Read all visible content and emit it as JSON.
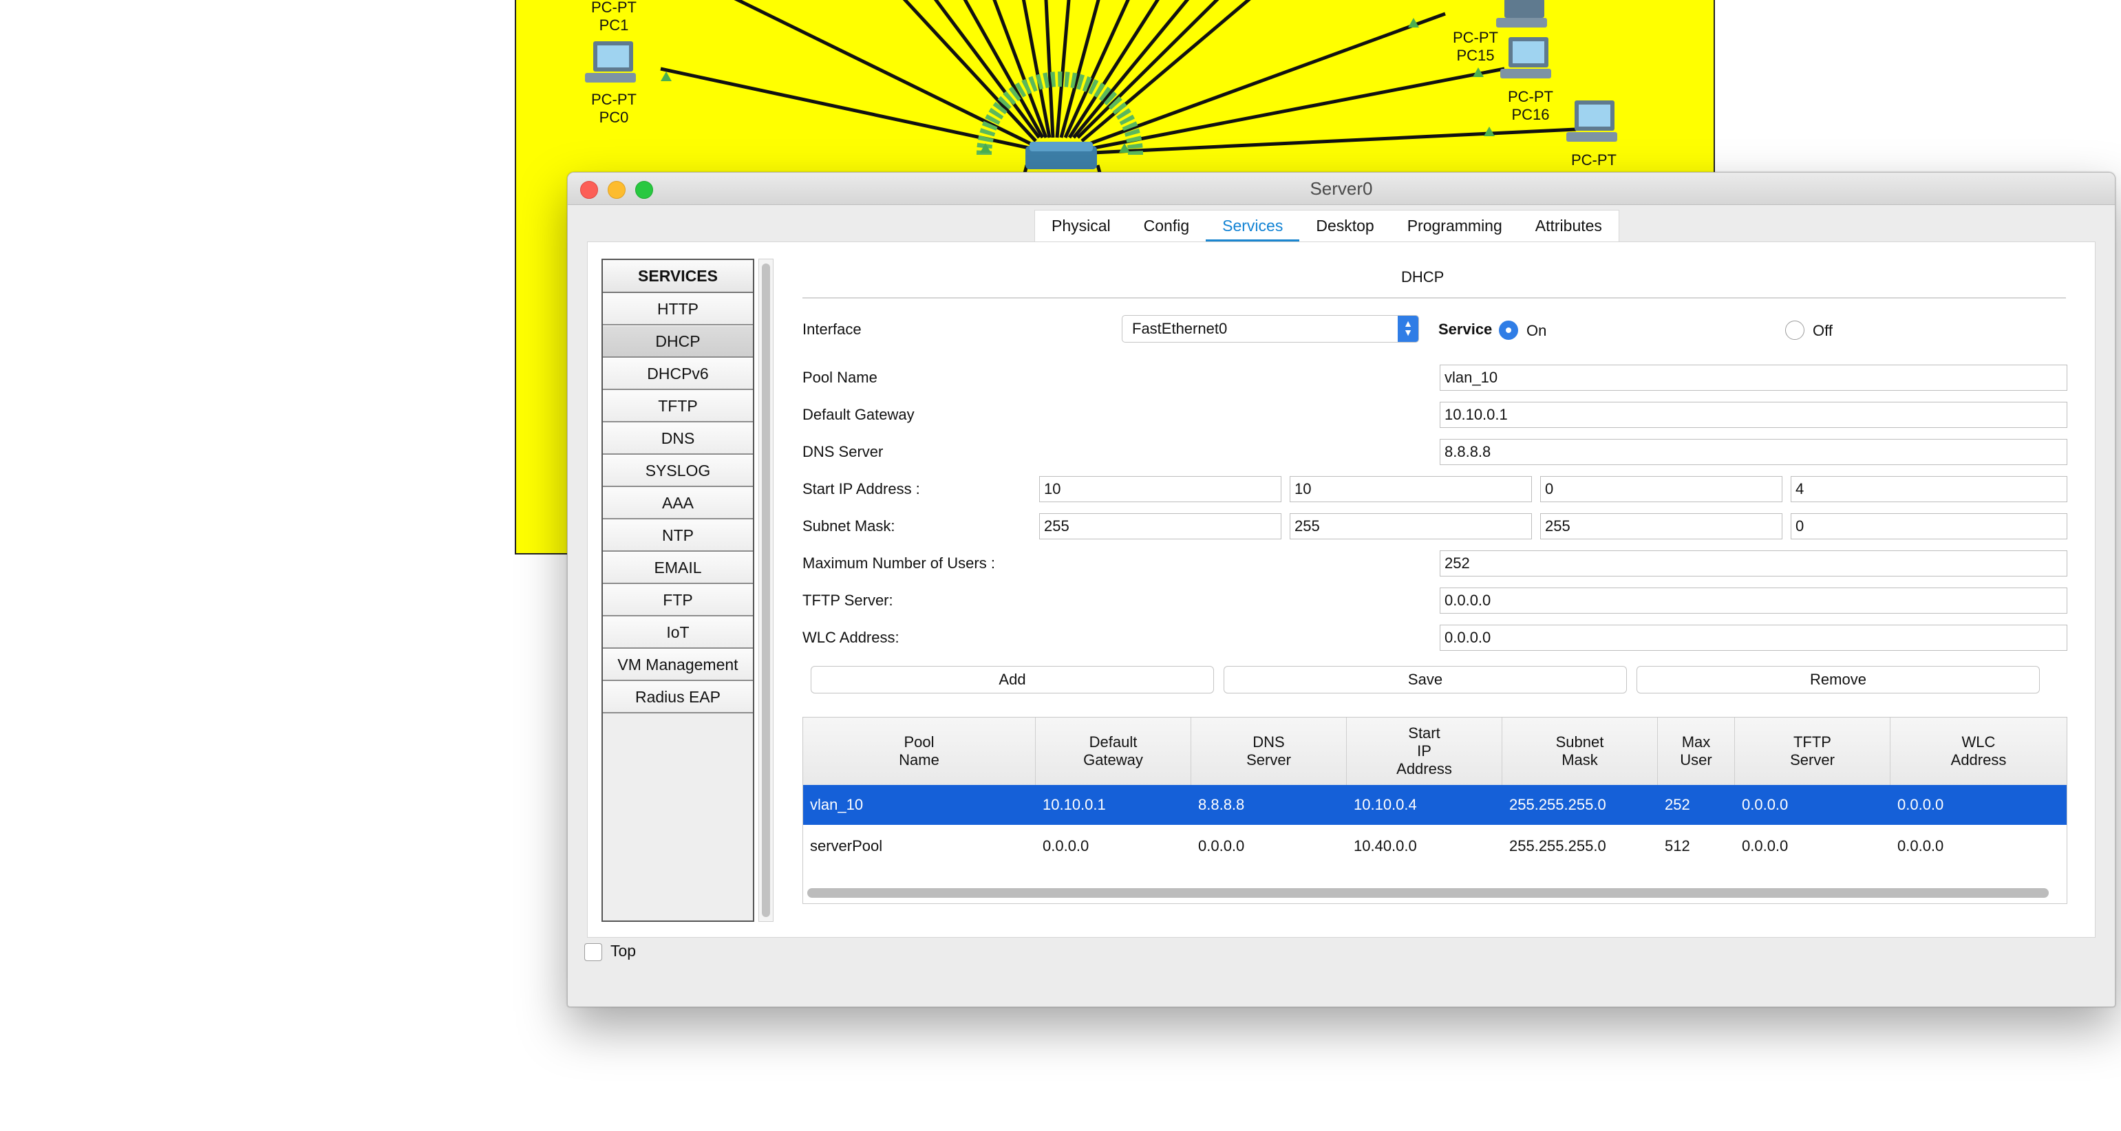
{
  "canvas": {
    "devices": [
      {
        "type": "PC-PT",
        "name": "PC1"
      },
      {
        "type": "PC-PT",
        "name": "PC0"
      },
      {
        "type": "PC-PT",
        "name": "PC15"
      },
      {
        "type": "PC-PT",
        "name": "PC16"
      },
      {
        "type": "PC-PT",
        "name": ""
      }
    ],
    "colors": {
      "background": "#ffff00",
      "link": "#111111",
      "port_up": "#4caf50"
    }
  },
  "window": {
    "title": "Server0",
    "tabs": [
      {
        "label": "Physical"
      },
      {
        "label": "Config"
      },
      {
        "label": "Services",
        "active": true
      },
      {
        "label": "Desktop"
      },
      {
        "label": "Programming"
      },
      {
        "label": "Attributes"
      }
    ],
    "services": {
      "header": "SERVICES",
      "items": [
        "HTTP",
        "DHCP",
        "DHCPv6",
        "TFTP",
        "DNS",
        "SYSLOG",
        "AAA",
        "NTP",
        "EMAIL",
        "FTP",
        "IoT",
        "VM Management",
        "Radius EAP"
      ],
      "selected": "DHCP"
    },
    "dhcp": {
      "title": "DHCP",
      "interface_label": "Interface",
      "interface_value": "FastEthernet0",
      "service_label": "Service",
      "on_label": "On",
      "off_label": "Off",
      "service_state": "On",
      "pool_name_label": "Pool Name",
      "pool_name": "vlan_10",
      "gateway_label": "Default Gateway",
      "gateway": "10.10.0.1",
      "dns_label": "DNS Server",
      "dns": "8.8.8.8",
      "start_ip_label": "Start IP Address :",
      "start_ip": [
        "10",
        "10",
        "0",
        "4"
      ],
      "mask_label": "Subnet Mask:",
      "mask": [
        "255",
        "255",
        "255",
        "0"
      ],
      "max_users_label": "Maximum Number of Users :",
      "max_users": "252",
      "tftp_label": "TFTP Server:",
      "tftp": "0.0.0.0",
      "wlc_label": "WLC Address:",
      "wlc": "0.0.0.0",
      "buttons": {
        "add": "Add",
        "save": "Save",
        "remove": "Remove"
      },
      "table": {
        "headers": [
          "Pool\nName",
          "Default\nGateway",
          "DNS\nServer",
          "Start\nIP\nAddress",
          "Subnet\nMask",
          "Max\nUser",
          "TFTP\nServer",
          "WLC\nAddress"
        ],
        "rows": [
          [
            "vlan_10",
            "10.10.0.1",
            "8.8.8.8",
            "10.10.0.4",
            "255.255.255.0",
            "252",
            "0.0.0.0",
            "0.0.0.0"
          ],
          [
            "serverPool",
            "0.0.0.0",
            "0.0.0.0",
            "10.40.0.0",
            "255.255.255.0",
            "512",
            "0.0.0.0",
            "0.0.0.0"
          ]
        ],
        "selected_row": 0
      }
    },
    "top_checkbox_label": "Top",
    "top_checked": false,
    "colors": {
      "accent": "#1b86d0",
      "selection": "#1560d8",
      "radio": "#2f7de6"
    }
  }
}
